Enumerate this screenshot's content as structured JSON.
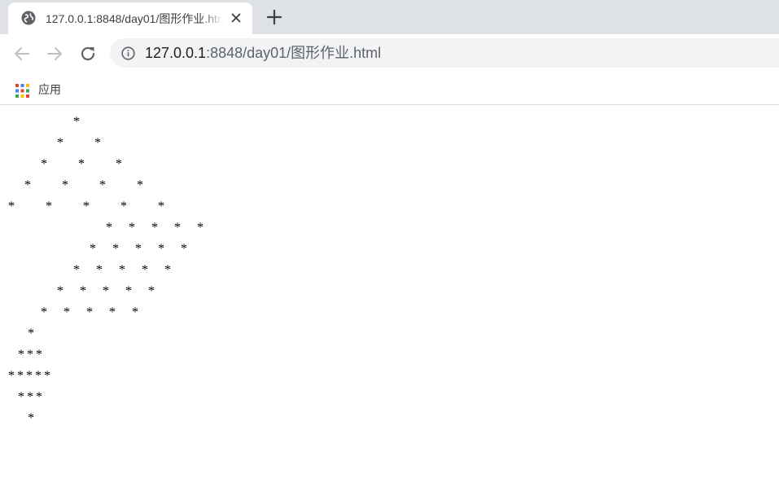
{
  "tab": {
    "title": "127.0.0.1:8848/day01/图形作业.html",
    "favicon": "globe-icon",
    "close_icon": "close-icon",
    "new_tab_icon": "plus-icon"
  },
  "toolbar": {
    "back_icon": "arrow-left-icon",
    "forward_icon": "arrow-right-icon",
    "reload_icon": "reload-icon",
    "info_icon": "info-icon"
  },
  "address": {
    "host": "127.0.0.1",
    "rest": ":8848/day01/图形作业.html"
  },
  "bookmarks": {
    "apps_label": "应用",
    "apps_icon": "apps-grid-icon"
  },
  "page": {
    "lines": [
      "*",
      "*  *",
      "*  *  *",
      "*  *  *  *",
      "*  *  *  *  *",
      "* * * * *",
      "* * * * *",
      "* * * * *",
      "* * * * *",
      "* * * * *",
      "*",
      "***",
      "*****",
      "***",
      "*"
    ]
  },
  "colors": {
    "tabstrip": "#dee1e6",
    "omnibox": "#f1f3f4",
    "url_host": "#202124",
    "url_rest": "#5f6368"
  }
}
